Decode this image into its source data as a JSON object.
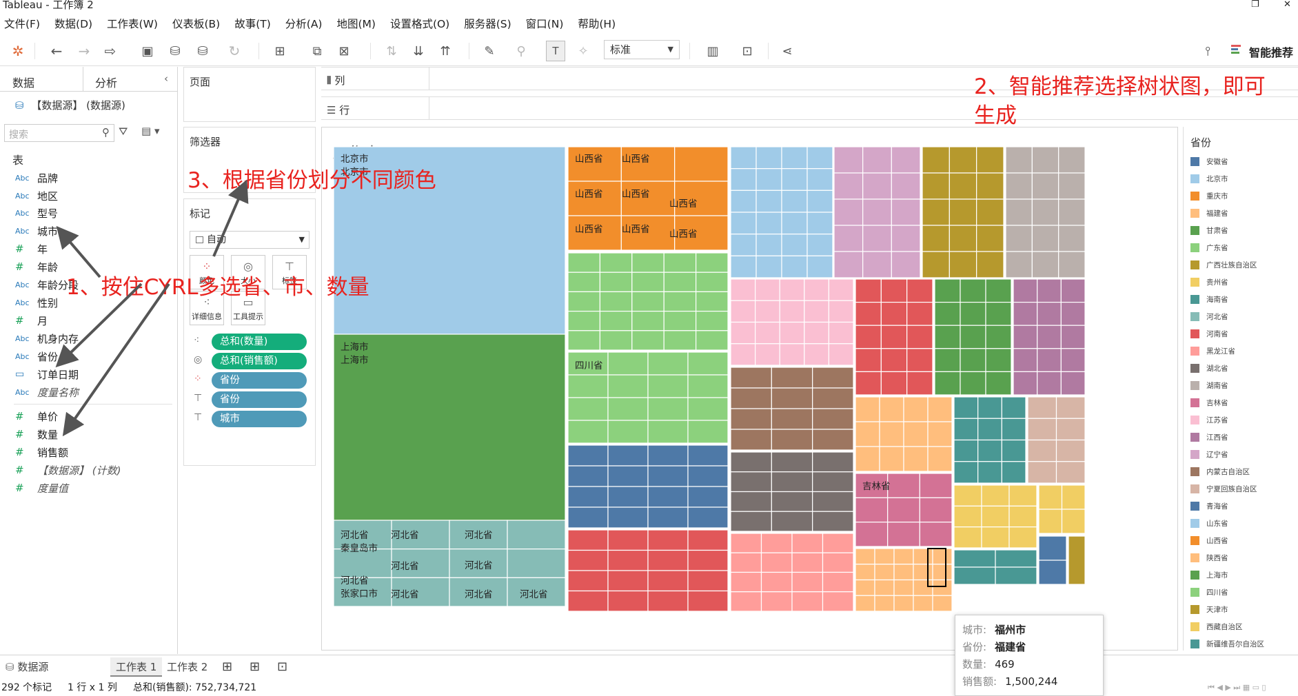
{
  "window": {
    "title": "Tableau - 工作簿 2"
  },
  "menu": [
    "文件(F)",
    "数据(D)",
    "工作表(W)",
    "仪表板(B)",
    "故事(T)",
    "分析(A)",
    "地图(M)",
    "设置格式(O)",
    "服务器(S)",
    "窗口(N)",
    "帮助(H)"
  ],
  "toolbar": {
    "fit_value": "标准",
    "smart_label": "智能推荐"
  },
  "datapane": {
    "tab_data": "数据",
    "tab_analysis": "分析",
    "datasource": "【数据源】 (数据源)",
    "search_placeholder": "搜索",
    "tables_label": "表",
    "fields": [
      {
        "type": "Abc",
        "name": "品牌"
      },
      {
        "type": "Abc",
        "name": "地区"
      },
      {
        "type": "Abc",
        "name": "型号"
      },
      {
        "type": "Abc",
        "name": "城市"
      },
      {
        "type": "#",
        "name": "年"
      },
      {
        "type": "#",
        "name": "年龄"
      },
      {
        "type": "Abc",
        "name": "年龄分段"
      },
      {
        "type": "Abc",
        "name": "性别"
      },
      {
        "type": "#",
        "name": "月"
      },
      {
        "type": "Abc",
        "name": "机身内存"
      },
      {
        "type": "Abc",
        "name": "省份"
      },
      {
        "type": "date",
        "name": "订单日期"
      },
      {
        "type": "Abc",
        "name": "度量名称"
      }
    ],
    "measures": [
      {
        "type": "#",
        "name": "单价"
      },
      {
        "type": "#",
        "name": "数量"
      },
      {
        "type": "#",
        "name": "销售额"
      },
      {
        "type": "#",
        "name": "【数据源】 (计数)"
      },
      {
        "type": "#",
        "name": "度量值"
      }
    ]
  },
  "shelves": {
    "pages": "页面",
    "filters": "筛选器",
    "marks": "标记",
    "mark_type": "自动",
    "mark_buttons": [
      "颜色",
      "大小",
      "标签",
      "详细信息",
      "工具提示"
    ],
    "columns": "列",
    "rows": "行",
    "pills": [
      {
        "label": "总和(数量)",
        "kind": "green"
      },
      {
        "label": "总和(销售额)",
        "kind": "green"
      },
      {
        "label": "省份",
        "kind": "blue"
      },
      {
        "label": "省份",
        "kind": "blue"
      },
      {
        "label": "城市",
        "kind": "blue"
      }
    ]
  },
  "sheet": {
    "title": "工作表 1"
  },
  "treemap_labels": {
    "beijing_prov": "北京市",
    "beijing_city": "北京市",
    "shanghai_prov": "上海市",
    "shanghai_city": "上海市",
    "shanxi": "山西省",
    "sichuan": "四川省",
    "hebei": "河北省",
    "qinhuangdao": "秦皇岛市",
    "zhangjiakou": "张家口市",
    "jilin": "吉林省"
  },
  "legend": {
    "title": "省份",
    "items": [
      {
        "name": "安徽省",
        "color": "#4e79a7"
      },
      {
        "name": "北京市",
        "color": "#a0cbe8"
      },
      {
        "name": "重庆市",
        "color": "#f28e2b"
      },
      {
        "name": "福建省",
        "color": "#ffbe7d"
      },
      {
        "name": "甘肃省",
        "color": "#59a14f"
      },
      {
        "name": "广东省",
        "color": "#8cd17d"
      },
      {
        "name": "广西壮族自治区",
        "color": "#b6992d"
      },
      {
        "name": "贵州省",
        "color": "#f1ce63"
      },
      {
        "name": "海南省",
        "color": "#499894"
      },
      {
        "name": "河北省",
        "color": "#86bcb6"
      },
      {
        "name": "河南省",
        "color": "#e15759"
      },
      {
        "name": "黑龙江省",
        "color": "#ff9d9a"
      },
      {
        "name": "湖北省",
        "color": "#79706e"
      },
      {
        "name": "湖南省",
        "color": "#bab0ac"
      },
      {
        "name": "吉林省",
        "color": "#d37295"
      },
      {
        "name": "江苏省",
        "color": "#fabfd2"
      },
      {
        "name": "江西省",
        "color": "#b07aa1"
      },
      {
        "name": "辽宁省",
        "color": "#d4a6c8"
      },
      {
        "name": "内蒙古自治区",
        "color": "#9d7660"
      },
      {
        "name": "宁夏回族自治区",
        "color": "#d7b5a6"
      },
      {
        "name": "青海省",
        "color": "#4e79a7"
      },
      {
        "name": "山东省",
        "color": "#a0cbe8"
      },
      {
        "name": "山西省",
        "color": "#f28e2b"
      },
      {
        "name": "陕西省",
        "color": "#ffbe7d"
      },
      {
        "name": "上海市",
        "color": "#59a14f"
      },
      {
        "name": "四川省",
        "color": "#8cd17d"
      },
      {
        "name": "天津市",
        "color": "#b6992d"
      },
      {
        "name": "西藏自治区",
        "color": "#f1ce63"
      },
      {
        "name": "新疆维吾尔自治区",
        "color": "#499894"
      }
    ]
  },
  "tabs": {
    "datasource": "数据源",
    "sheet1": "工作表 1",
    "sheet2": "工作表 2"
  },
  "status": {
    "marks": "292 个标记",
    "dims": "1 行 x 1 列",
    "sum": "总和(销售额): 752,734,721"
  },
  "tooltip": {
    "city_label": "城市:",
    "city_value": "福州市",
    "prov_label": "省份:",
    "prov_value": "福建省",
    "qty_label": "数量:",
    "qty_value": "469",
    "sales_label": "销售额:",
    "sales_value": "1,500,244"
  },
  "annotations": {
    "a1": "1、按住CYRL多选省、市、数量",
    "a2_line1": "2、智能推荐选择树状图，即可",
    "a2_line2": "生成",
    "a3": "3、根据省份划分不同颜色"
  }
}
